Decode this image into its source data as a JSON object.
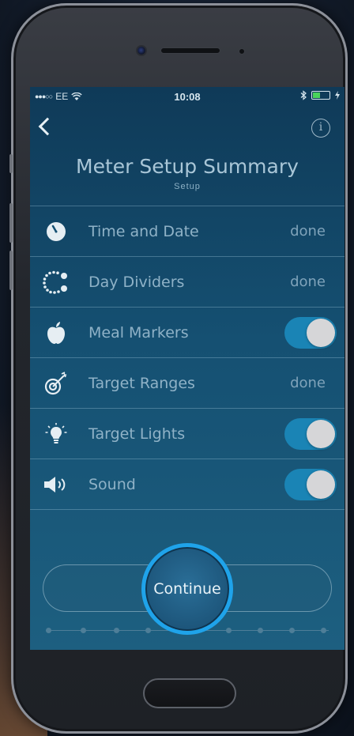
{
  "statusbar": {
    "carrier": "EE",
    "time": "10:08"
  },
  "header": {
    "title": "Meter Setup Summary",
    "subtitle": "Setup"
  },
  "items": [
    {
      "label": "Time and Date",
      "status": "done",
      "icon": "clock-icon"
    },
    {
      "label": "Day Dividers",
      "status": "done",
      "icon": "day-dividers-icon"
    },
    {
      "label": "Meal Markers",
      "toggle": true,
      "icon": "apple-icon"
    },
    {
      "label": "Target Ranges",
      "status": "done",
      "icon": "target-icon"
    },
    {
      "label": "Target Lights",
      "toggle": true,
      "icon": "lightbulb-icon"
    },
    {
      "label": "Sound",
      "toggle": true,
      "icon": "speaker-icon"
    }
  ],
  "continue_label": "Continue",
  "colors": {
    "accent": "#1fa3ea",
    "toggle_on": "#1a84b5",
    "background": "#155072"
  }
}
